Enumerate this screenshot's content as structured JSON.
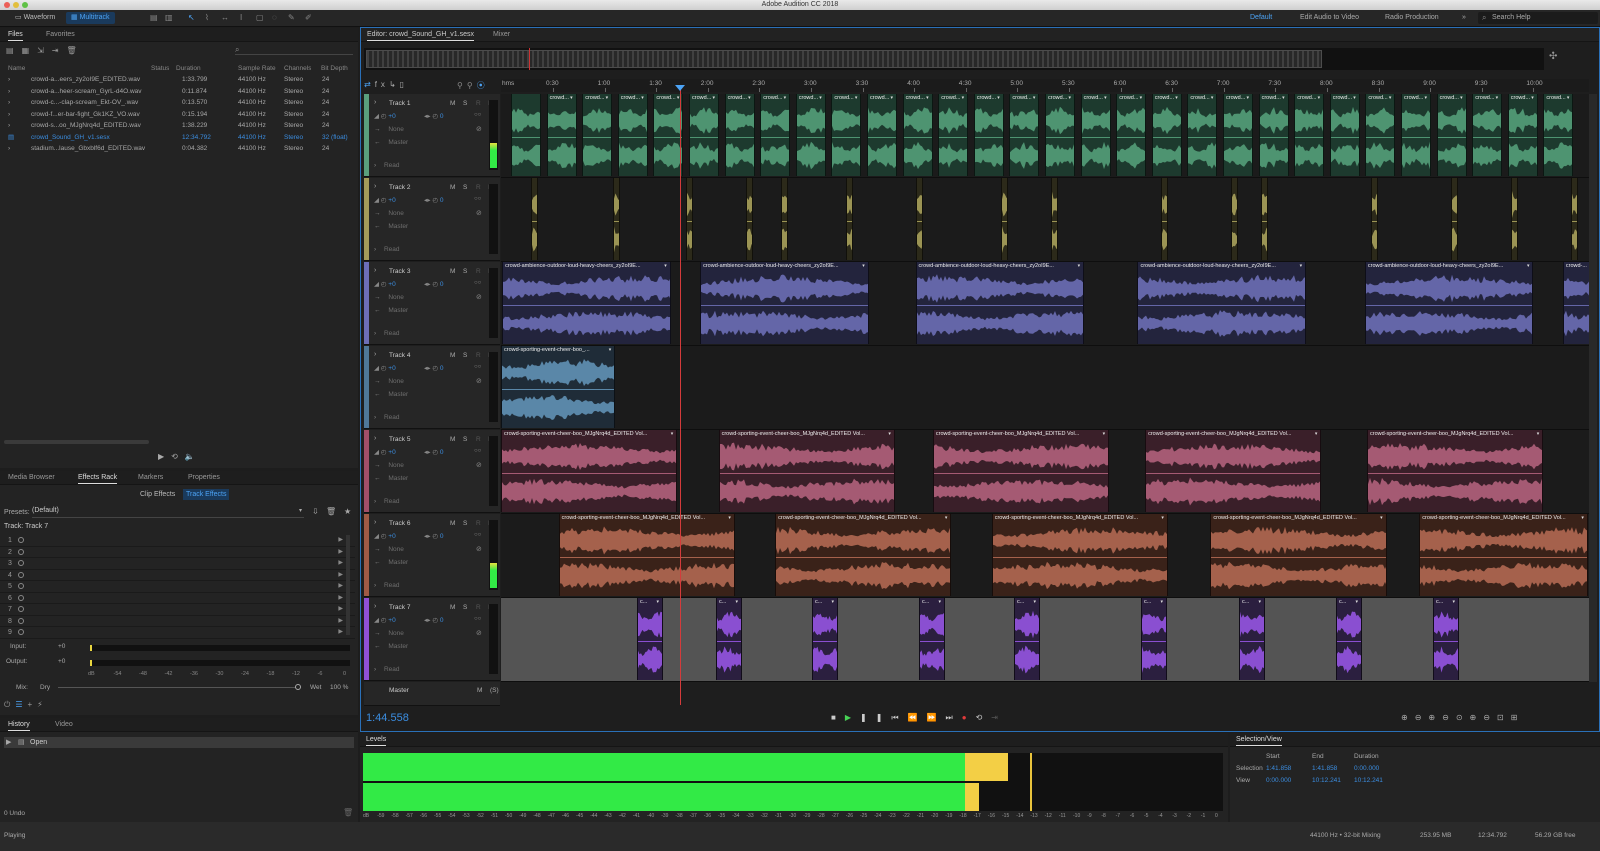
{
  "app": {
    "title": "Adobe Audition CC 2018"
  },
  "toolbar": {
    "waveform": "Waveform",
    "multitrack": "Multitrack",
    "workspaces": [
      "Default",
      "Edit Audio to Video",
      "Radio Production"
    ],
    "search_placeholder": "Search Help"
  },
  "files_panel": {
    "tabs": [
      "Files",
      "Favorites"
    ],
    "columns": [
      "Name",
      "Status",
      "Duration",
      "Sample Rate",
      "Channels",
      "Bit Depth"
    ],
    "rows": [
      {
        "name": "crowd-a...eers_zy2oI9E_EDITED.wav",
        "duration": "1:33.799",
        "rate": "44100 Hz",
        "channels": "Stereo",
        "depth": "24"
      },
      {
        "name": "crowd-a...heer-scream_GyrL-d4O.wav",
        "duration": "0:11.874",
        "rate": "44100 Hz",
        "channels": "Stereo",
        "depth": "24"
      },
      {
        "name": "crowd-c...-clap-scream_Ekt-OV_.wav",
        "duration": "0:13.570",
        "rate": "44100 Hz",
        "channels": "Stereo",
        "depth": "24"
      },
      {
        "name": "crowd-f...er-bar-fight_Gk1KZ_VO.wav",
        "duration": "0:15.194",
        "rate": "44100 Hz",
        "channels": "Stereo",
        "depth": "24"
      },
      {
        "name": "crowd-s...oo_MJgNrq4d_EDITED.wav",
        "duration": "1:38.229",
        "rate": "44100 Hz",
        "channels": "Stereo",
        "depth": "24"
      },
      {
        "name": "crowd_Sound_GH_v1.sesx",
        "duration": "12:34.792",
        "rate": "44100 Hz",
        "channels": "Stereo",
        "depth": "32 (float)"
      },
      {
        "name": "stadium...lause_Gbxblf6d_EDITED.wav",
        "duration": "0:04.382",
        "rate": "44100 Hz",
        "channels": "Stereo",
        "depth": "24"
      }
    ]
  },
  "effects_panel": {
    "tabs": [
      "Media Browser",
      "Effects Rack",
      "Markers",
      "Properties"
    ],
    "subtabs": [
      "Clip Effects",
      "Track Effects"
    ],
    "presets_label": "Presets:",
    "presets_value": "(Default)",
    "track_label": "Track: Track 7",
    "slots": [
      "1",
      "2",
      "3",
      "4",
      "5",
      "6",
      "7",
      "8",
      "9"
    ],
    "input_label": "Input:",
    "output_label": "Output:",
    "gain": "+0",
    "meter_ticks": [
      "dB",
      "-54",
      "-48",
      "-42",
      "-36",
      "-30",
      "-24",
      "-18",
      "-12",
      "-6",
      "0"
    ],
    "mix_label": "Mix:",
    "dry": "Dry",
    "wet": "Wet",
    "wet_value": "100 %"
  },
  "history_panel": {
    "tabs": [
      "History",
      "Video"
    ],
    "items": [
      "Open"
    ],
    "undo": "0 Undo"
  },
  "editor": {
    "tab": "Editor: crowd_Sound_GH_v1.sesx",
    "mixer_tab": "Mixer",
    "time": "1:44.558",
    "ruler": [
      "hms",
      "0:30",
      "1:00",
      "1:30",
      "2:00",
      "2:30",
      "3:00",
      "3:30",
      "4:00",
      "4:30",
      "5:00",
      "5:30",
      "6:00",
      "6:30",
      "7:00",
      "7:30",
      "8:00",
      "8:30",
      "9:00",
      "9:30",
      "10:00"
    ],
    "track_fields": {
      "volume": "+0",
      "pan": "0",
      "fx": "None",
      "out": "Master",
      "auto": "Read"
    },
    "master_label": "Master",
    "tracks": [
      {
        "name": "Track 1",
        "color": "#5a9f7d",
        "wave": "#4e9471",
        "clipbg": "#1d3a2e",
        "clips": [
          {
            "label": "crowd...",
            "s": 0,
            "w": 0.03
          }
        ],
        "pattern": "short"
      },
      {
        "name": "Track 2",
        "color": "#a49b5a",
        "wave": "#9b9454",
        "clipbg": "#2c2a1a",
        "pattern": "thin"
      },
      {
        "name": "Track 3",
        "color": "#6d6fb8",
        "wave": "#6466a8",
        "clipbg": "#23243d",
        "clips": [
          {
            "label": "crowd-ambience-outdoor-loud-heavy-cheers_zy2oI9E...",
            "s": 0.001,
            "w": 0.155
          },
          {
            "label": "crowd-ambience-outdoor-loud-heavy-cheers_zy2oI9E...",
            "s": 0.183,
            "w": 0.155
          },
          {
            "label": "crowd-ambience-outdoor-loud-heavy-cheers_zy2oI9E...",
            "s": 0.381,
            "w": 0.155
          },
          {
            "label": "crowd-ambience-outdoor-loud-heavy-cheers_zy2oI9E...",
            "s": 0.585,
            "w": 0.155
          },
          {
            "label": "crowd-ambience-outdoor-loud-heavy-cheers_zy2oI9E...",
            "s": 0.794,
            "w": 0.155
          },
          {
            "label": "crowd-...",
            "s": 0.976,
            "w": 0.03
          }
        ]
      },
      {
        "name": "Track 4",
        "color": "#4f7899",
        "wave": "#5a87a8",
        "clipbg": "#1f2c38",
        "clips": [
          {
            "label": "crowd-sporting-event-cheer-boo_...",
            "s": 0,
            "w": 0.105
          }
        ]
      },
      {
        "name": "Track 5",
        "color": "#a24f68",
        "wave": "#a55a73",
        "clipbg": "#3a1f29",
        "clips": [
          {
            "label": "crowd-sporting-event-cheer-boo_MJgNrq4d_EDITED Vol...",
            "s": 0,
            "w": 0.162
          },
          {
            "label": "crowd-sporting-event-cheer-boo_MJgNrq4d_EDITED Vol...",
            "s": 0.2,
            "w": 0.162
          },
          {
            "label": "crowd-sporting-event-cheer-boo_MJgNrq4d_EDITED Vol...",
            "s": 0.397,
            "w": 0.162
          },
          {
            "label": "crowd-sporting-event-cheer-boo_MJgNrq4d_EDITED Vol...",
            "s": 0.592,
            "w": 0.162
          },
          {
            "label": "crowd-sporting-event-cheer-boo_MJgNrq4d_EDITED Vol...",
            "s": 0.796,
            "w": 0.162
          }
        ]
      },
      {
        "name": "Track 6",
        "color": "#a15a45",
        "wave": "#a5614c",
        "clipbg": "#3a2219",
        "clips": [
          {
            "label": "crowd-sporting-event-cheer-boo_MJgNrq4d_EDITED Vol...",
            "s": 0.053,
            "w": 0.162
          },
          {
            "label": "crowd-sporting-event-cheer-boo_MJgNrq4d_EDITED Vol...",
            "s": 0.252,
            "w": 0.162
          },
          {
            "label": "crowd-sporting-event-cheer-boo_MJgNrq4d_EDITED Vol...",
            "s": 0.451,
            "w": 0.162
          },
          {
            "label": "crowd-sporting-event-cheer-boo_MJgNrq4d_EDITED Vol...",
            "s": 0.652,
            "w": 0.162
          },
          {
            "label": "crowd-sporting-event-cheer-boo_MJgNrq4d_EDITED Vol...",
            "s": 0.844,
            "w": 0.155
          }
        ]
      },
      {
        "name": "Track 7",
        "color": "#9150d6",
        "wave": "#8a4fd1",
        "clipbg": "#2b1f3f",
        "pattern": "purple"
      }
    ]
  },
  "levels": {
    "title": "Levels",
    "ticks": [
      "dB",
      "-59",
      "-58",
      "-57",
      "-56",
      "-55",
      "-54",
      "-53",
      "-52",
      "-51",
      "-50",
      "-49",
      "-48",
      "-47",
      "-46",
      "-45",
      "-44",
      "-43",
      "-42",
      "-41",
      "-40",
      "-39",
      "-38",
      "-37",
      "-36",
      "-35",
      "-34",
      "-33",
      "-32",
      "-31",
      "-30",
      "-29",
      "-28",
      "-27",
      "-26",
      "-25",
      "-24",
      "-23",
      "-22",
      "-21",
      "-20",
      "-19",
      "-18",
      "-17",
      "-16",
      "-15",
      "-14",
      "-13",
      "-12",
      "-11",
      "-10",
      "-9",
      "-8",
      "-7",
      "-6",
      "-5",
      "-4",
      "-3",
      "-2",
      "-1",
      "0"
    ],
    "left_level_db": -15.0,
    "right_level_db": -17.0
  },
  "selection_view": {
    "title": "Selection/View",
    "cols": [
      "Start",
      "End",
      "Duration"
    ],
    "rows": [
      {
        "label": "Selection",
        "start": "1:41.858",
        "end": "1:41.858",
        "dur": "0:00.000"
      },
      {
        "label": "View",
        "start": "0:00.000",
        "end": "10:12.241",
        "dur": "10:12.241"
      }
    ]
  },
  "status": {
    "left": "Playing",
    "rate": "44100 Hz • 32-bit Mixing",
    "mem": "253.95 MB",
    "dur": "12:34.792",
    "free": "56.29 GB free"
  }
}
